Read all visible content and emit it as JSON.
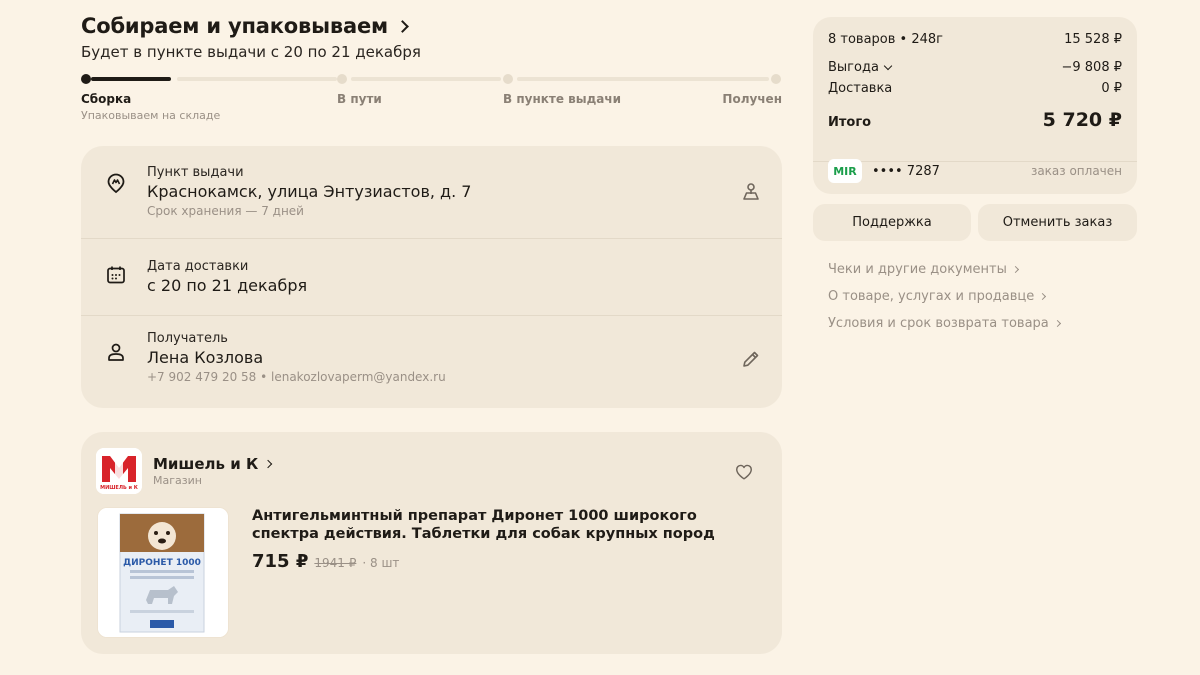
{
  "header": {
    "title": "Собираем и упаковываем",
    "subtitle": "Будет в пункте выдачи с 20 по 21 декабря"
  },
  "progress": {
    "steps": [
      "Сборка",
      "В пути",
      "В пункте выдачи",
      "Получен"
    ],
    "current_step_sub": "Упаковываем на складе",
    "current_index": 0
  },
  "pickup": {
    "label": "Пункт выдачи",
    "address": "Краснокамск, улица Энтузиастов, д. 7",
    "storage": "Срок хранения — 7 дней"
  },
  "delivery": {
    "label": "Дата доставки",
    "date": "с 20 по 21 декабря"
  },
  "recipient": {
    "label": "Получатель",
    "name": "Лена Козлова",
    "contacts": "+7 902 479 20 58 • lenakozlovaperm@yandex.ru"
  },
  "shop": {
    "name": "Мишель и К",
    "type": "Магазин",
    "logo_text": "МИШЕЛЬ и К"
  },
  "product": {
    "name": "Антигельминтный препарат Диронет 1000 широкого спектра действия. Таблетки для собак крупных пород",
    "price": "715 ₽",
    "old_price": "1941 ₽",
    "quantity": "· 8 шт",
    "image_text": "ДИРОНЕТ 1000"
  },
  "summary": {
    "items": "8 товаров • 248г",
    "items_sum": "15 528 ₽",
    "discount_label": "Выгода",
    "discount_value": "−9 808 ₽",
    "delivery_label": "Доставка",
    "delivery_value": "0 ₽",
    "total_label": "Итого",
    "total_value": "5 720 ₽",
    "card_brand": "MIR",
    "card_number": "•••• 7287",
    "payment_status": "заказ оплачен"
  },
  "buttons": {
    "support": "Поддержка",
    "cancel": "Отменить заказ"
  },
  "links": [
    "Чеки и другие документы",
    "О товаре, услугах и продавце",
    "Условия и срок возврата товара"
  ],
  "colors": {
    "background": "#fbf3e6",
    "card": "#f1e8d9",
    "text": "#1f1b16",
    "muted": "#9a9086",
    "mir_green": "#1b9e4b"
  }
}
